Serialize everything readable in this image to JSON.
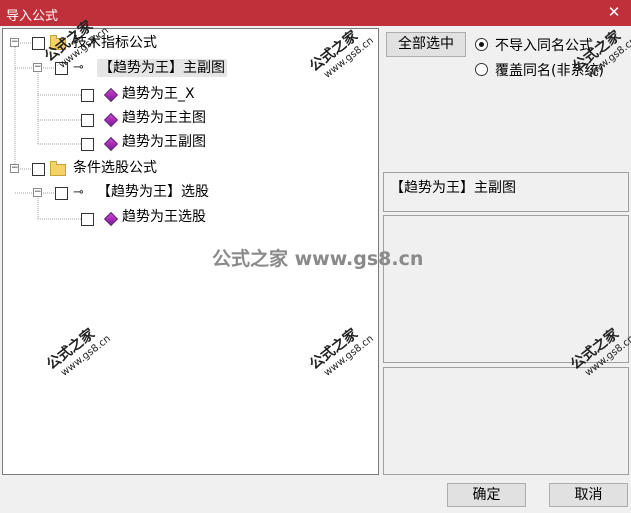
{
  "window": {
    "title": "导入公式",
    "close_glyph": "✕"
  },
  "tree": {
    "nodes": [
      {
        "id": "grp1",
        "label": "技术指标公式",
        "type": "folder",
        "expander": "−"
      },
      {
        "id": "item1",
        "label": "【趋势为王】主副图",
        "type": "key",
        "expander": "−",
        "selected": true
      },
      {
        "id": "sub1",
        "label": "趋势为王_X",
        "type": "gem"
      },
      {
        "id": "sub2",
        "label": "趋势为王主图",
        "type": "gem"
      },
      {
        "id": "sub3",
        "label": "趋势为王副图",
        "type": "gem"
      },
      {
        "id": "grp2",
        "label": "条件选股公式",
        "type": "folder",
        "expander": "−"
      },
      {
        "id": "item2",
        "label": "【趋势为王】选股",
        "type": "key",
        "expander": "−"
      },
      {
        "id": "sub4",
        "label": "趋势为王选股",
        "type": "gem"
      }
    ]
  },
  "options": {
    "select_all_label": "全部选中",
    "radio_no_import": "不导入同名公式",
    "radio_overwrite": "覆盖同名(非系统)",
    "selected_radio": "no_import"
  },
  "preview": {
    "title": "【趋势为王】主副图"
  },
  "buttons": {
    "ok": "确定",
    "cancel": "取消"
  },
  "watermark": {
    "center_text": "公式之家 www.gs8.cn",
    "stamp_text": "公式之家",
    "stamp_url": "www.gs8.cn"
  },
  "colors": {
    "titlebar": "#c0303b"
  }
}
